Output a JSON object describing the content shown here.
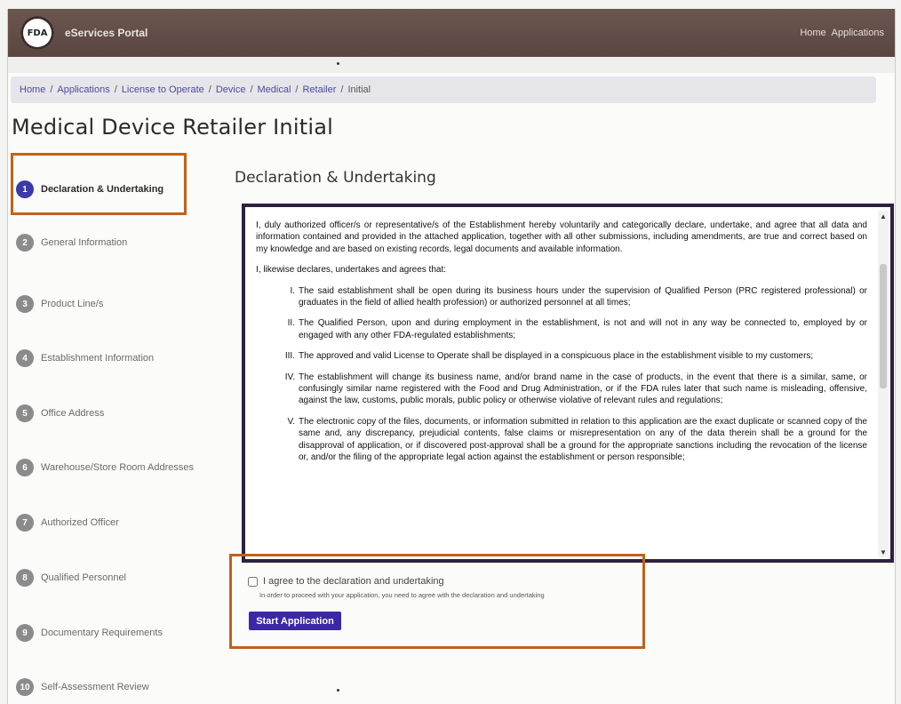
{
  "header": {
    "logo_text": "FDA",
    "portal_name": "eServices Portal",
    "nav": [
      "Home",
      "Applications"
    ]
  },
  "breadcrumb": [
    "Home",
    "Applications",
    "License to Operate",
    "Device",
    "Medical",
    "Retailer",
    "Initial"
  ],
  "page_title": "Medical Device Retailer Initial",
  "steps": [
    {
      "num": "1",
      "label": "Declaration & Undertaking"
    },
    {
      "num": "2",
      "label": "General Information"
    },
    {
      "num": "3",
      "label": "Product Line/s"
    },
    {
      "num": "4",
      "label": "Establishment Information"
    },
    {
      "num": "5",
      "label": "Office Address"
    },
    {
      "num": "6",
      "label": "Warehouse/Store Room Addresses"
    },
    {
      "num": "7",
      "label": "Authorized Officer"
    },
    {
      "num": "8",
      "label": "Qualified Personnel"
    },
    {
      "num": "9",
      "label": "Documentary Requirements"
    },
    {
      "num": "10",
      "label": "Self-Assessment Review"
    }
  ],
  "section_title": "Declaration & Undertaking",
  "declaration": {
    "intro": "I, duly authorized officer/s or representative/s of the Establishment hereby voluntarily and categorically declare, undertake, and agree that all data and information contained and provided in the attached application, together with all other submissions, including amendments, are true and correct based on my knowledge and are based on existing records, legal documents and available information.",
    "lead": "I, likewise declares, undertakes and agrees that:",
    "items": [
      {
        "roman": "I.",
        "text": "The said establishment shall be open during its business hours under the supervision of Qualified Person (PRC registered professional) or graduates in the field of allied health profession) or authorized personnel at all times;"
      },
      {
        "roman": "II.",
        "text": "The Qualified Person, upon and during employment in the establishment, is not and will not in any way be connected to, employed by or engaged with any other FDA-regulated establishments;"
      },
      {
        "roman": "III.",
        "text": "The approved and valid License to Operate shall be displayed in a conspicuous place in the establishment visible to my customers;"
      },
      {
        "roman": "IV.",
        "text": "The establishment will change its business name, and/or brand name in the case of products, in the event that there is a similar, same, or confusingly similar name registered with the Food and Drug Administration, or if the FDA rules later that such name is misleading, offensive, against the law, customs, public morals, public policy or otherwise violative of relevant rules and regulations;"
      },
      {
        "roman": "V.",
        "text": "The electronic copy of the files, documents, or information submitted in relation to this application are the exact duplicate or scanned copy of the same and, any discrepancy, prejudicial contents, false claims or misrepresentation on any of the data therein shall be a ground for the disapproval of application, or if discovered post-approval shall be a ground for the appropriate sanctions including the revocation of the license or, and/or the filing of the appropriate legal action against the establishment or person responsible;"
      }
    ]
  },
  "agree": {
    "label": "I agree to the declaration and undertaking",
    "hint": "In order to proceed with your application, you need to agree with the declaration and undertaking"
  },
  "start_button": "Start Application"
}
